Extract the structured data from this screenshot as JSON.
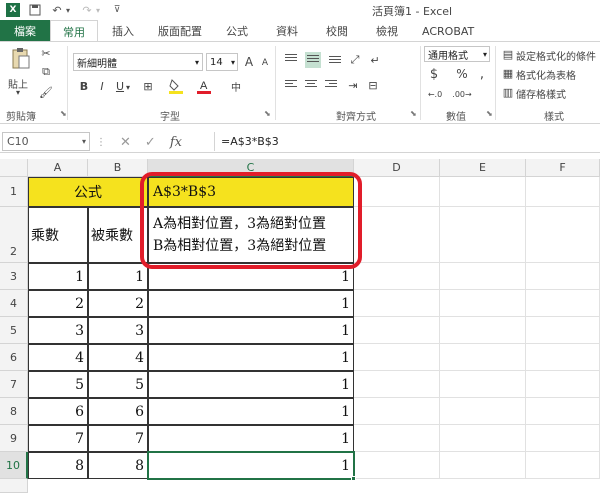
{
  "titlebar": {
    "app_icon": "X",
    "title": "活頁簿1 - Excel"
  },
  "tabs": [
    "檔案",
    "常用",
    "插入",
    "版面配置",
    "公式",
    "資料",
    "校閱",
    "檢視",
    "ACROBAT"
  ],
  "ribbon": {
    "clipboard": {
      "paste_label": "貼上",
      "group": "剪貼簿"
    },
    "font": {
      "name": "新細明體",
      "size": "14",
      "group": "字型",
      "bold": "B",
      "italic": "I",
      "underline": "U",
      "grow": "A",
      "shrink": "A",
      "phonetic": "中"
    },
    "alignment": {
      "group": "對齊方式"
    },
    "number": {
      "format": "通用格式",
      "currency": "$",
      "percent": "%",
      "comma": ",",
      "group": "數值",
      "inc": "←.0",
      "dec": ".00→"
    },
    "styles": {
      "conditional": "設定格式化的條件",
      "table": "格式化為表格",
      "cell": "儲存格樣式",
      "group": "樣式"
    }
  },
  "formula_bar": {
    "name_box": "C10",
    "formula": "=A$3*B$3",
    "fx": "fx"
  },
  "columns": [
    "A",
    "B",
    "C",
    "D",
    "E",
    "F"
  ],
  "rows": [
    "1",
    "2",
    "3",
    "4",
    "5",
    "6",
    "7",
    "8",
    "9",
    "10"
  ],
  "cells": {
    "A1": "公式",
    "C1": "A$3*B$3",
    "A2": "乘數",
    "B2": "被乘數",
    "C2_line1": "A為相對位置，3為絕對位置",
    "C2_line2": "B為相對位置，3為絕對位置",
    "data": [
      {
        "a": "1",
        "b": "1",
        "c": "1"
      },
      {
        "a": "2",
        "b": "2",
        "c": "1"
      },
      {
        "a": "3",
        "b": "3",
        "c": "1"
      },
      {
        "a": "4",
        "b": "4",
        "c": "1"
      },
      {
        "a": "5",
        "b": "5",
        "c": "1"
      },
      {
        "a": "6",
        "b": "6",
        "c": "1"
      },
      {
        "a": "7",
        "b": "7",
        "c": "1"
      },
      {
        "a": "8",
        "b": "8",
        "c": "1"
      }
    ]
  },
  "colors": {
    "accent": "#217346",
    "highlight": "#f5e21e",
    "callout": "#e11d2a"
  }
}
